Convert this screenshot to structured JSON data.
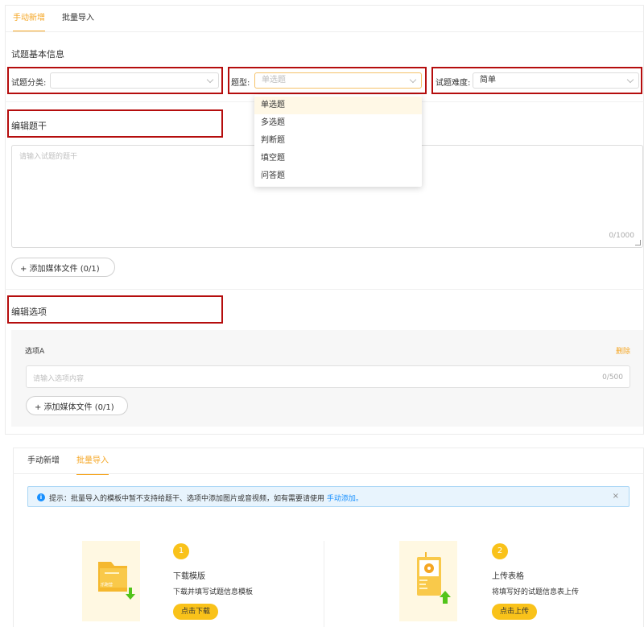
{
  "top_panel": {
    "tabs": [
      {
        "label": "手动新增",
        "active": true
      },
      {
        "label": "批量导入",
        "active": false
      }
    ],
    "basic_info_title": "试题基本信息",
    "category_label": "试题分类:",
    "category_value": "",
    "type_label": "题型:",
    "type_placeholder": "单选题",
    "difficulty_label": "试题难度:",
    "difficulty_value": "简单",
    "type_options": [
      "单选题",
      "多选题",
      "判断题",
      "填空题",
      "问答题"
    ],
    "stem_title": "编辑题干",
    "stem_placeholder": "请输入试题的题干",
    "stem_counter": "0/1000",
    "media_button": "+ 添加媒体文件 (0/1)",
    "options_title": "编辑选项",
    "option_a_label": "选项A",
    "option_delete": "删除",
    "option_placeholder": "请输入选项内容",
    "option_counter": "0/500",
    "option_media_button": "+ 添加媒体文件 (0/1)"
  },
  "bottom_panel": {
    "tabs": [
      {
        "label": "手动新增",
        "active": false
      },
      {
        "label": "批量导入",
        "active": true
      }
    ],
    "alert_text": "提示：批量导入的模板中暂不支持给题干、选项中添加图片或音视频，如有需要请使用",
    "alert_link": "手动添加。",
    "alert_close": "×",
    "step1": {
      "num": "1",
      "title": "下载模版",
      "desc": "下载并填写试题信息模板",
      "button": "点击下载",
      "illus_text": "乐跑营"
    },
    "step2": {
      "num": "2",
      "title": "上传表格",
      "desc": "将填写好的试题信息表上传",
      "button": "点击上传"
    }
  },
  "colors": {
    "accent": "#f5a623",
    "highlight": "#b50d0d",
    "step": "#f9c21a",
    "info": "#1890ff"
  }
}
